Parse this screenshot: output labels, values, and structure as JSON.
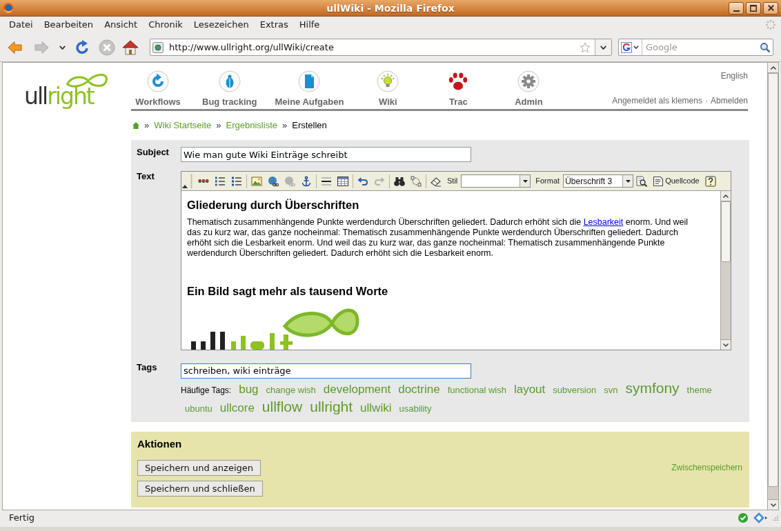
{
  "window": {
    "title": "ullWiki - Mozilla Firefox"
  },
  "menu": [
    "Datei",
    "Bearbeiten",
    "Ansicht",
    "Chronik",
    "Lesezeichen",
    "Extras",
    "Hilfe"
  ],
  "nav_buttons": [
    {
      "disabled": false
    },
    {
      "disabled": true
    },
    {
      "disabled": false
    },
    {
      "disabled": true
    },
    {
      "disabled": false
    }
  ],
  "address_bar": {
    "value": "http://www.ullright.org/ullWiki/create"
  },
  "search_bar": {
    "placeholder": "Google"
  },
  "site": {
    "logo": {
      "part_1": "ull",
      "part_2": "right"
    },
    "nav": [
      "Workflows",
      "Bug tracking",
      "Meine Aufgaben",
      "Wiki",
      "Trac",
      "Admin"
    ],
    "language": "English",
    "user": {
      "status": "Angemeldet als klemens",
      "separator": "·",
      "logout": "Abmelden"
    }
  },
  "breadcrumb": {
    "separator": "»",
    "items": [
      {
        "label": "Wiki Startseite",
        "current": false
      },
      {
        "label": "Ergebnisliste",
        "current": false
      },
      {
        "label": "Erstellen",
        "current": true
      }
    ]
  },
  "form": {
    "subject": {
      "label": "Subject",
      "value": "Wie man gute Wiki Einträge schreibt"
    },
    "text": {
      "label": "Text",
      "toolbar": {
        "buttons": [
          {
            "disabled": false
          },
          {
            "disabled": false
          },
          {
            "disabled": false
          },
          {
            "disabled": false
          },
          {
            "disabled": false
          },
          {
            "disabled": true
          },
          {
            "disabled": false
          },
          {
            "disabled": false
          },
          {
            "disabled": false
          },
          {
            "disabled": false
          },
          {
            "disabled": true
          },
          {
            "disabled": false
          },
          {
            "disabled": false
          },
          {
            "disabled": false
          },
          {
            "disabled": false
          },
          {
            "disabled": false
          }
        ],
        "style_label": "Stil",
        "format_label": "Format",
        "format_value": "Überschrift 3",
        "source_label": "Quellcode"
      },
      "content": {
        "heading_1": "Gliederung durch Überschriften",
        "paragraph": {
          "before": "Thematisch zusammenhängende Punkte werdendurch Überschriften geliedert. Dadurch erhöht sich die ",
          "link": "Lesbarkeit",
          "after": " enorm. Und weil das zu kurz war, das ganze nocheinmal: Thematisch zusammenhängende Punkte werdendurch Überschriften geliedert. Dadurch erhöht sich die Lesbarkeit enorm. Und weil das zu kurz war, das ganze nocheinmal: Thematisch zusammenhängende Punkte werdendurch Überschriften geliedert. Dadurch erhöht sich die Lesbarkeit enorm."
        },
        "heading_2": "Ein Bild sagt mehr als tausend Worte"
      }
    },
    "tags": {
      "label": "Tags",
      "value": "schreiben, wiki einträge",
      "focused": true,
      "popular_label": "Häufige Tags:",
      "popular": [
        {
          "label": "bug",
          "kind": "medium"
        },
        {
          "label": "change wish",
          "kind": "small"
        },
        {
          "label": "development",
          "kind": "medium"
        },
        {
          "label": "doctrine",
          "kind": "medium"
        },
        {
          "label": "functional wish",
          "kind": "small"
        },
        {
          "label": "layout",
          "kind": "medium"
        },
        {
          "label": "subversion",
          "kind": "small"
        },
        {
          "label": "svn",
          "kind": "small"
        },
        {
          "label": "symfony",
          "kind": "large"
        },
        {
          "label": "theme",
          "kind": "small"
        },
        {
          "label": "ubuntu",
          "kind": "small"
        },
        {
          "label": "ullcore",
          "kind": "medium"
        },
        {
          "label": "ullflow",
          "kind": "large"
        },
        {
          "label": "ullright",
          "kind": "large"
        },
        {
          "label": "ullwiki",
          "kind": "medium"
        },
        {
          "label": "usability",
          "kind": "small"
        }
      ]
    }
  },
  "actions": {
    "title": "Aktionen",
    "buttons": [
      "Speichern und anzeigen",
      "Speichern und schließen"
    ],
    "link": "Zwischenspeichern"
  },
  "status_bar": {
    "text": "Fertig"
  }
}
